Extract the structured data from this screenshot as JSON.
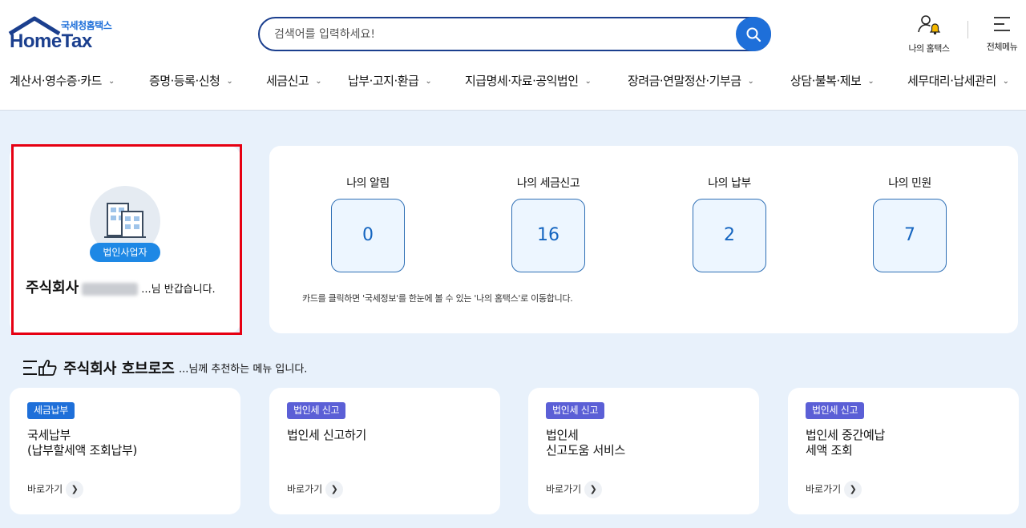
{
  "header": {
    "logo_sub": "국세청홈택스",
    "logo_main": "HomeTax",
    "search_placeholder": "검색어를 입력하세요!",
    "my_hometax_label": "나의 홈택스",
    "all_menu_label": "전체메뉴"
  },
  "gnb": [
    {
      "label": "계산서·영수증·카드"
    },
    {
      "label": "증명·등록·신청"
    },
    {
      "label": "세금신고"
    },
    {
      "label": "납부·고지·환급"
    },
    {
      "label": "지급명세·자료·공익법인"
    },
    {
      "label": "장려금·연말정산·기부금"
    },
    {
      "label": "상담·불복·제보"
    },
    {
      "label": "세무대리·납세관리"
    }
  ],
  "profile": {
    "badge": "법인사업자",
    "name": "주식회사",
    "suffix": "...님 반갑습니다."
  },
  "stats": {
    "items": [
      {
        "title": "나의 알림",
        "value": "0"
      },
      {
        "title": "나의 세금신고",
        "value": "16"
      },
      {
        "title": "나의 납부",
        "value": "2"
      },
      {
        "title": "나의 민원",
        "value": "7"
      }
    ],
    "note": "카드를 클릭하면 '국세정보'를 한눈에 볼 수 있는 '나의 홈택스'로 이동합니다."
  },
  "recommend": {
    "company": "주식회사 호브로즈",
    "suffix": "...님께 추천하는 메뉴 입니다.",
    "link_label": "바로가기",
    "cards": [
      {
        "badge": "세금납부",
        "title": "국세납부\n(납부할세액 조회납부)"
      },
      {
        "badge": "법인세 신고",
        "title": "법인세 신고하기"
      },
      {
        "badge": "법인세 신고",
        "title": "법인세\n신고도움 서비스"
      },
      {
        "badge": "법인세 신고",
        "title": "법인세 중간예납\n세액 조회"
      }
    ]
  },
  "colors": {
    "brand_navy": "#1b3f8e",
    "accent_blue": "#1e6fd9",
    "badge_purple": "#5b5fd6",
    "highlight_red": "#e60012",
    "page_bg": "#e8f1fb"
  }
}
